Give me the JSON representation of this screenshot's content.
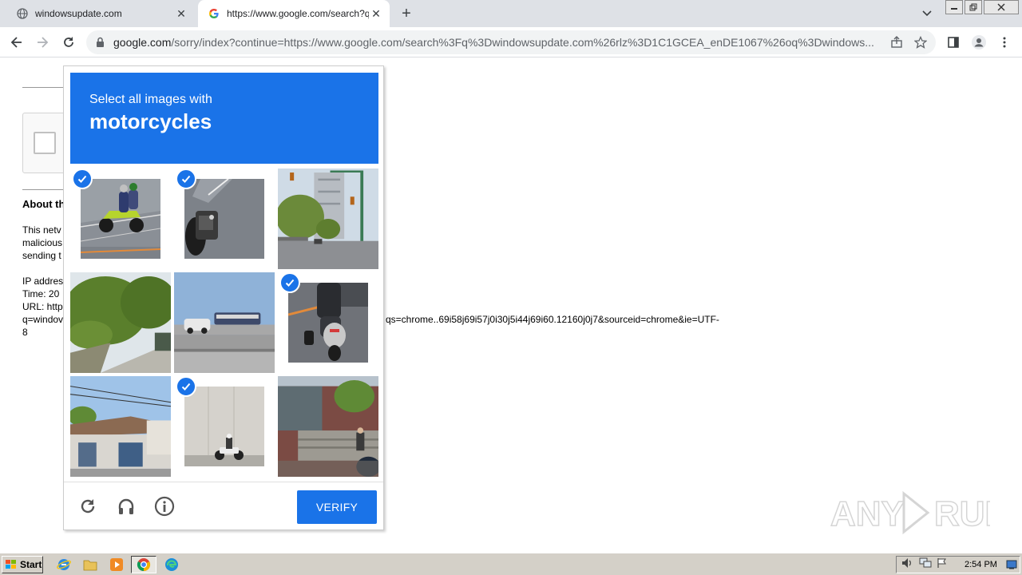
{
  "browser": {
    "tabs": [
      {
        "title": "windowsupdate.com",
        "active": false
      },
      {
        "title": "https://www.google.com/search?q=",
        "active": true
      }
    ],
    "new_tab_label": "+",
    "address": {
      "host": "google.com",
      "path": "/sorry/index?continue=https://www.google.com/search%3Fq%3Dwindowsupdate.com%26rlz%3D1C1GCEA_enDE1067%26oq%3Dwindows..."
    }
  },
  "page": {
    "about_heading": "About th",
    "para_lines": [
      "This netv",
      "malicious",
      "sending t"
    ],
    "ip_lines": [
      "IP addres",
      "Time: 20",
      "URL: http",
      "q=windov",
      "8"
    ],
    "url_tail": "qs=chrome..69i58j69i57j0i30j5i44j69i60.12160j0j7&sourceid=chrome&ie=UTF-"
  },
  "captcha": {
    "instruction": "Select all images with",
    "target": "motorcycles",
    "tiles": [
      {
        "id": "t1",
        "selected": true
      },
      {
        "id": "t2",
        "selected": true
      },
      {
        "id": "t3",
        "selected": false
      },
      {
        "id": "t4",
        "selected": false
      },
      {
        "id": "t5",
        "selected": false
      },
      {
        "id": "t6",
        "selected": true
      },
      {
        "id": "t7",
        "selected": false
      },
      {
        "id": "t8",
        "selected": true
      },
      {
        "id": "t9",
        "selected": false
      }
    ],
    "verify_label": "VERIFY",
    "colors": {
      "accent": "#1a73e8"
    }
  },
  "watermark": {
    "text": "ANY RUN"
  },
  "taskbar": {
    "start_label": "Start",
    "clock": "2:54 PM"
  }
}
